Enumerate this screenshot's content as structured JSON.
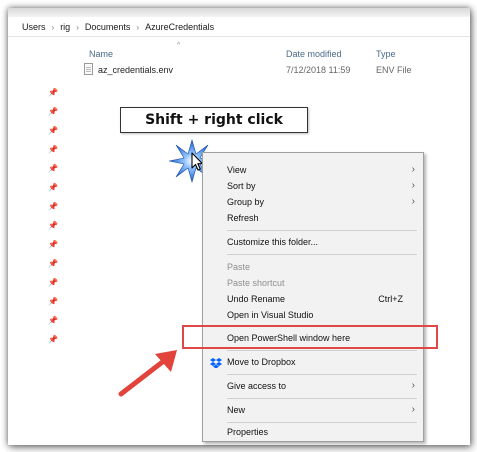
{
  "breadcrumb": {
    "items": [
      "Users",
      "rig",
      "Documents",
      "AzureCredentials"
    ],
    "separator": "›"
  },
  "columns": {
    "name": "Name",
    "date_modified": "Date modified",
    "type": "Type"
  },
  "file": {
    "name": "az_credentials.env",
    "date": "7/12/2018 11:59",
    "type": "ENV File"
  },
  "callout": {
    "text": "Shift + right click"
  },
  "context_menu": {
    "view": "View",
    "sort_by": "Sort by",
    "group_by": "Group by",
    "refresh": "Refresh",
    "customize": "Customize this folder...",
    "paste": "Paste",
    "paste_shortcut": "Paste shortcut",
    "undo_rename": "Undo Rename",
    "undo_shortcut": "Ctrl+Z",
    "open_vs": "Open in Visual Studio",
    "open_powershell": "Open PowerShell window here",
    "move_dropbox": "Move to Dropbox",
    "give_access": "Give access to",
    "new": "New",
    "properties": "Properties"
  },
  "colors": {
    "highlight_box": "#e04848",
    "arrow": "#e2443c",
    "starburst": "#2b7be0",
    "dropbox": "#0061fe"
  }
}
